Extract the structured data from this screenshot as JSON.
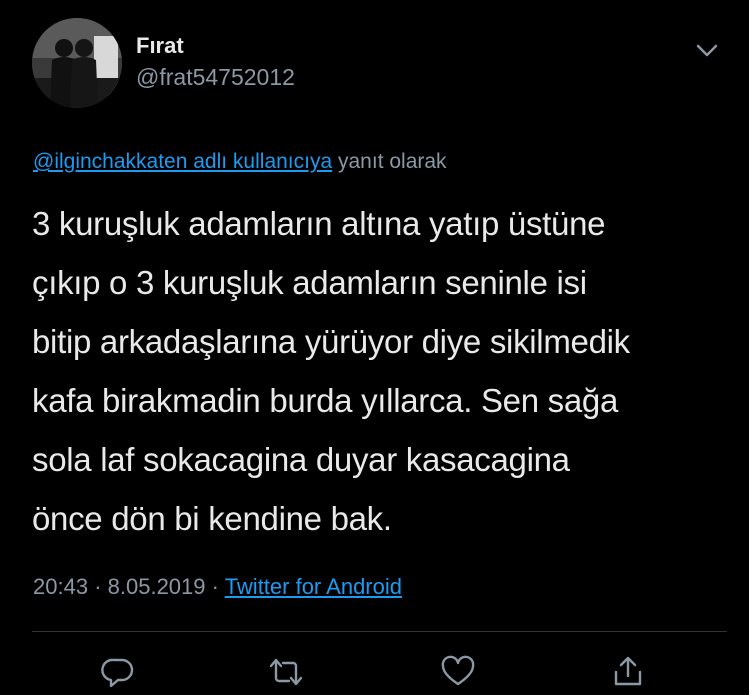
{
  "author": {
    "display_name": "Fırat",
    "handle": "@frat54752012",
    "avatar_icon": "profile-photo-two-figures"
  },
  "reply": {
    "mention": "@ilginchakkaten adlı kullanıcıya",
    "suffix": "yanıt olarak"
  },
  "tweet": {
    "lines": [
      "3 kuruşluk adamların altına yatıp üstüne",
      "çıkıp o 3 kuruşluk adamların seninle isi",
      "bitip arkadaşlarına yürüyor diye sikilmedik",
      "kafa birakmadin  burda yıllarca. Sen sağa",
      "sola laf sokacagina duyar kasacagina",
      "önce dön bi kendine bak."
    ]
  },
  "meta": {
    "time": "20:43",
    "sep1": "·",
    "date": "8.05.2019",
    "sep2": "·",
    "source": "Twitter for Android"
  },
  "actions": [
    "reply-icon",
    "retweet-icon",
    "like-icon",
    "share-icon"
  ],
  "colors": {
    "background": "#000000",
    "text": "#e9e9ea",
    "secondary": "#8b98a5",
    "link": "#1d9bf0",
    "divider": "#2f3336"
  }
}
